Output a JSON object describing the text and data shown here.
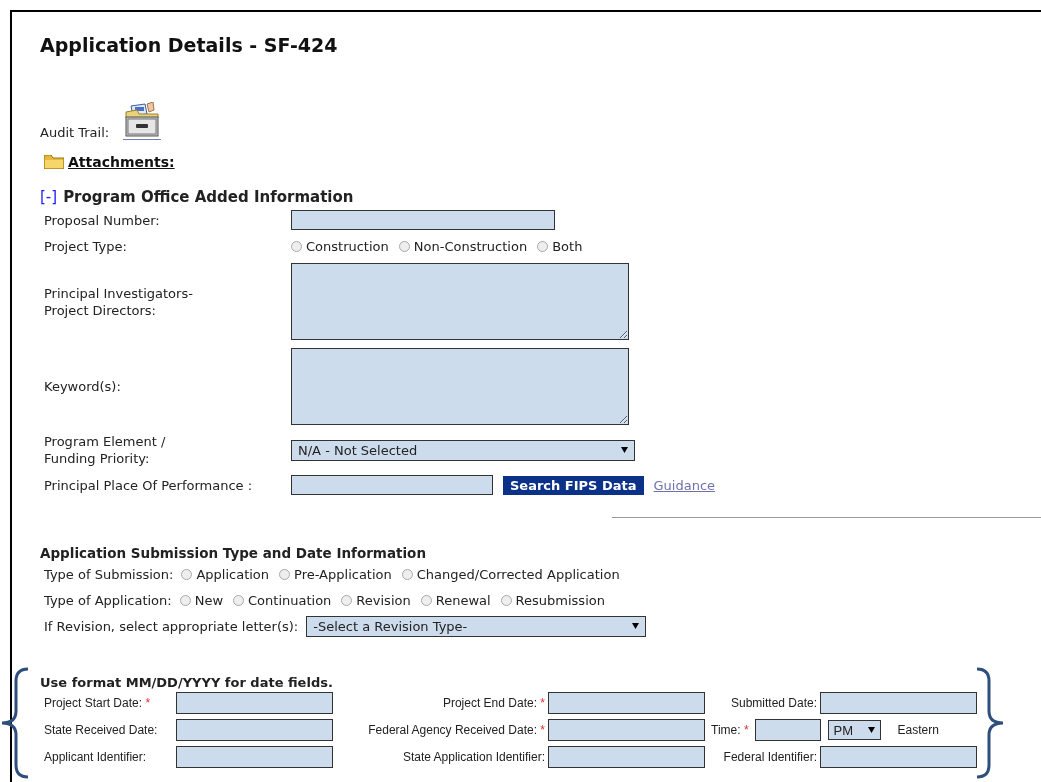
{
  "title": "Application Details - SF-424",
  "audit_trail": {
    "label": "Audit Trail:"
  },
  "attachments": {
    "label": "Attachments:"
  },
  "program_office": {
    "toggle": "[-]",
    "title": "Program Office Added Information",
    "fields": [
      {
        "kind": "text",
        "label": "Proposal Number:"
      },
      {
        "kind": "radio",
        "label": "Project Type:",
        "options": [
          {
            "label": "Construction",
            "selected": false
          },
          {
            "label": "Non-Construction",
            "selected": false
          },
          {
            "label": "Both",
            "selected": false
          }
        ]
      },
      {
        "kind": "textarea",
        "label": "Principal Investigators-\nProject Directors:"
      },
      {
        "kind": "textarea",
        "label": "Keyword(s):"
      },
      {
        "kind": "select",
        "label": "Program Element /\nFunding Priority:",
        "value": "N/A - Not Selected"
      },
      {
        "kind": "search",
        "label": "Principal Place Of Performance :",
        "button": "Search FIPS Data",
        "link": "Guidance"
      }
    ]
  },
  "submission": {
    "title": "Application Submission Type and Date Information",
    "fields": [
      {
        "kind": "radio",
        "label": "Type of Submission:",
        "options": [
          {
            "label": "Application",
            "selected": false
          },
          {
            "label": "Pre-Application",
            "selected": false
          },
          {
            "label": "Changed/Corrected Application",
            "selected": false
          }
        ]
      },
      {
        "kind": "radio",
        "label": "Type of Application:",
        "options": [
          {
            "label": "New",
            "selected": false
          },
          {
            "label": "Continuation",
            "selected": false
          },
          {
            "label": "Revision",
            "selected": false
          },
          {
            "label": "Renewal",
            "selected": false
          },
          {
            "label": "Resubmission",
            "selected": false
          }
        ]
      },
      {
        "kind": "select",
        "label": "If Revision, select appropriate letter(s):",
        "value": "-Select a Revision Type-"
      }
    ]
  },
  "dates": {
    "note": "Use format MM/DD/YYYY for date fields.",
    "rows": [
      [
        {
          "label": "Project Start Date:",
          "required_mark": "*"
        },
        {
          "label": "Project End Date:",
          "required_mark": "*"
        },
        {
          "label": "Submitted Date:"
        }
      ],
      [
        {
          "label": "State Received Date:"
        },
        {
          "label": "Federal Agency Received Date:",
          "required_mark": "*"
        },
        {
          "kind": "time",
          "label": "Time:",
          "required_mark": "*",
          "period": "PM",
          "zone": "Eastern"
        }
      ],
      [
        {
          "label": "Applicant Identifier:"
        },
        {
          "label": "State Application Identifier:"
        },
        {
          "label": "Federal Identifier:"
        }
      ]
    ]
  }
}
